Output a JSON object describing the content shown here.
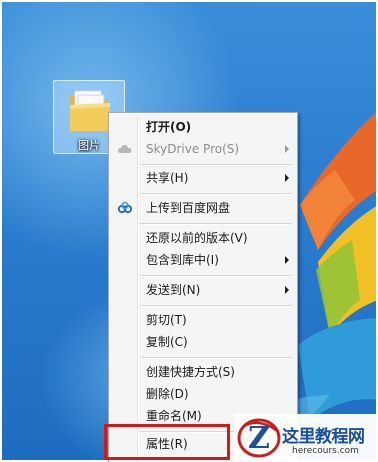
{
  "desktop": {
    "folder_label": "图片"
  },
  "context_menu": {
    "items": [
      {
        "label": "打开(O)",
        "bold": true
      },
      {
        "label": "SkyDrive Pro(S)",
        "disabled": true,
        "submenu": true,
        "icon": "skydrive-cloud-icon"
      },
      {
        "label": "共享(H)",
        "submenu": true
      },
      {
        "label": "上传到百度网盘",
        "icon": "baidu-netdisk-icon"
      },
      {
        "label": "还原以前的版本(V)"
      },
      {
        "label": "包含到库中(I)",
        "submenu": true
      },
      {
        "label": "发送到(N)",
        "submenu": true
      },
      {
        "label": "剪切(T)"
      },
      {
        "label": "复制(C)"
      },
      {
        "label": "创建快捷方式(S)"
      },
      {
        "label": "删除(D)"
      },
      {
        "label": "重命名(M)"
      },
      {
        "label": "属性(R)",
        "highlighted": true
      }
    ]
  },
  "watermark": {
    "title": "这里教程网",
    "url": "herecours.com"
  },
  "colors": {
    "highlight_border": "#cc1b1b",
    "desktop_blue": "#2b7ed0",
    "watermark_blue": "#1a4f9c"
  }
}
